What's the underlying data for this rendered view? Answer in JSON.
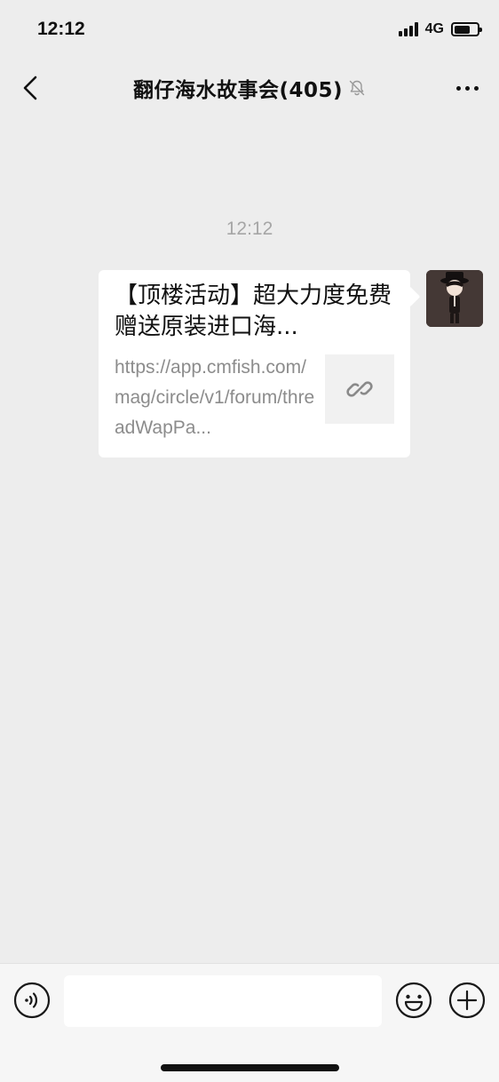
{
  "status_bar": {
    "time": "12:12",
    "network": "4G",
    "signal_bars": 4,
    "battery_level": 0.7
  },
  "nav": {
    "title": "翻仔海水故事会(405)",
    "muted": true,
    "back_icon": "chevron-left-icon",
    "more_icon": "more-dots-icon"
  },
  "chat": {
    "timestamp": "12:12",
    "messages": [
      {
        "type": "link-card",
        "sender": "self",
        "title": "【顶楼活动】超大力度免费赠送原装进口海...",
        "description": "https://app.cmfish.com/mag/circle/v1/forum/threadWapPa...",
        "thumbnail_icon": "link-icon"
      }
    ]
  },
  "input_bar": {
    "voice_icon": "voice-icon",
    "input_value": "",
    "emoji_icon": "emoji-icon",
    "plus_icon": "plus-circle-icon"
  },
  "colors": {
    "background": "#ededed",
    "bubble": "#ffffff",
    "muted_text": "#a6a6a6"
  }
}
